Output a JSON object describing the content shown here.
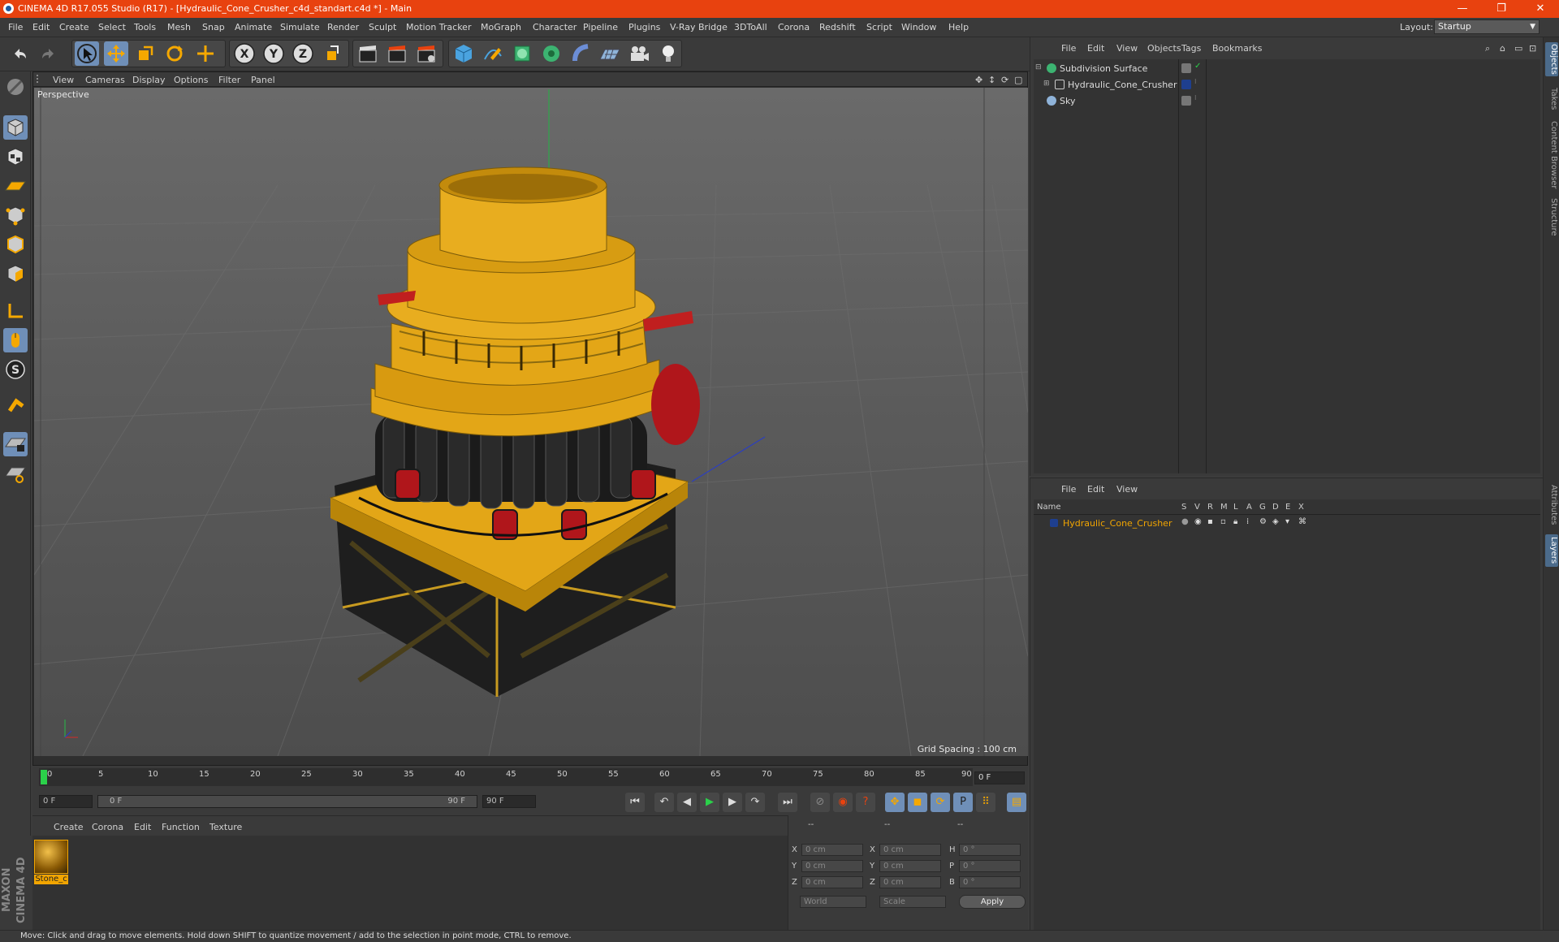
{
  "window": {
    "title": "CINEMA 4D R17.055 Studio (R17) - [Hydraulic_Cone_Crusher_c4d_standart.c4d *] - Main",
    "minimize": "—",
    "restore": "❐",
    "close": "✕"
  },
  "menubar": {
    "items": [
      "File",
      "Edit",
      "Create",
      "Select",
      "Tools",
      "Mesh",
      "Snap",
      "Animate",
      "Simulate",
      "Render",
      "Sculpt",
      "Motion Tracker",
      "MoGraph",
      "Character",
      "Pipeline",
      "Plugins",
      "V-Ray Bridge",
      "3DToAll",
      "Corona",
      "Redshift",
      "Script",
      "Window",
      "Help"
    ],
    "layout_label": "Layout:",
    "layout_value": "Startup"
  },
  "toolbar": {
    "axis_x": "X",
    "axis_y": "Y",
    "axis_z": "Z"
  },
  "viewport": {
    "menu": [
      "View",
      "Cameras",
      "Display",
      "Options",
      "Filter",
      "Panel"
    ],
    "label": "Perspective",
    "grid_spacing": "Grid Spacing : 100 cm"
  },
  "timeline": {
    "ticks": [
      "0",
      "5",
      "10",
      "15",
      "20",
      "25",
      "30",
      "35",
      "40",
      "45",
      "50",
      "55",
      "60",
      "65",
      "70",
      "75",
      "80",
      "85",
      "90"
    ],
    "current_frame_field": "0 F",
    "start_field": "0 F",
    "range_start": "0 F",
    "range_end": "90 F",
    "end_field": "90 F"
  },
  "materials": {
    "menu": [
      "Create",
      "Corona",
      "Edit",
      "Function",
      "Texture"
    ],
    "items": [
      {
        "name": "Stone_c"
      }
    ]
  },
  "coordinates": {
    "header": [
      "--",
      "--",
      "--"
    ],
    "rows": [
      {
        "a": "X",
        "av": "0 cm",
        "b": "X",
        "bv": "0 cm",
        "c": "H",
        "cv": "0 °"
      },
      {
        "a": "Y",
        "av": "0 cm",
        "b": "Y",
        "bv": "0 cm",
        "c": "P",
        "cv": "0 °"
      },
      {
        "a": "Z",
        "av": "0 cm",
        "b": "Z",
        "bv": "0 cm",
        "c": "B",
        "cv": "0 °"
      }
    ],
    "mode_select": "World",
    "scale_select": "Scale",
    "apply": "Apply"
  },
  "object_manager": {
    "menu": [
      "File",
      "Edit",
      "View",
      "Objects",
      "Tags",
      "Bookmarks"
    ],
    "objects": [
      {
        "name": "Subdivision Surface",
        "color": "#4caf50"
      },
      {
        "name": "Hydraulic_Cone_Crusher",
        "color": "#1e3f8f"
      },
      {
        "name": "Sky",
        "color": "#8fb3d9"
      }
    ]
  },
  "layer_manager": {
    "menu": [
      "File",
      "Edit",
      "View"
    ],
    "columns": [
      "Name",
      "S",
      "V",
      "R",
      "M",
      "L",
      "A",
      "G",
      "D",
      "E",
      "X"
    ],
    "layers": [
      {
        "name": "Hydraulic_Cone_Crusher",
        "color": "#1e3f8f"
      }
    ]
  },
  "right_tabs": [
    "Objects",
    "Takes",
    "Content Browser",
    "Structure",
    "Attributes",
    "Layers"
  ],
  "status": "Move: Click and drag to move elements. Hold down SHIFT to quantize movement / add to the selection in point mode, CTRL to remove.",
  "colors": {
    "accent": "#e8420f",
    "selection": "#6f8fb8",
    "material_label": "#f2a500"
  }
}
